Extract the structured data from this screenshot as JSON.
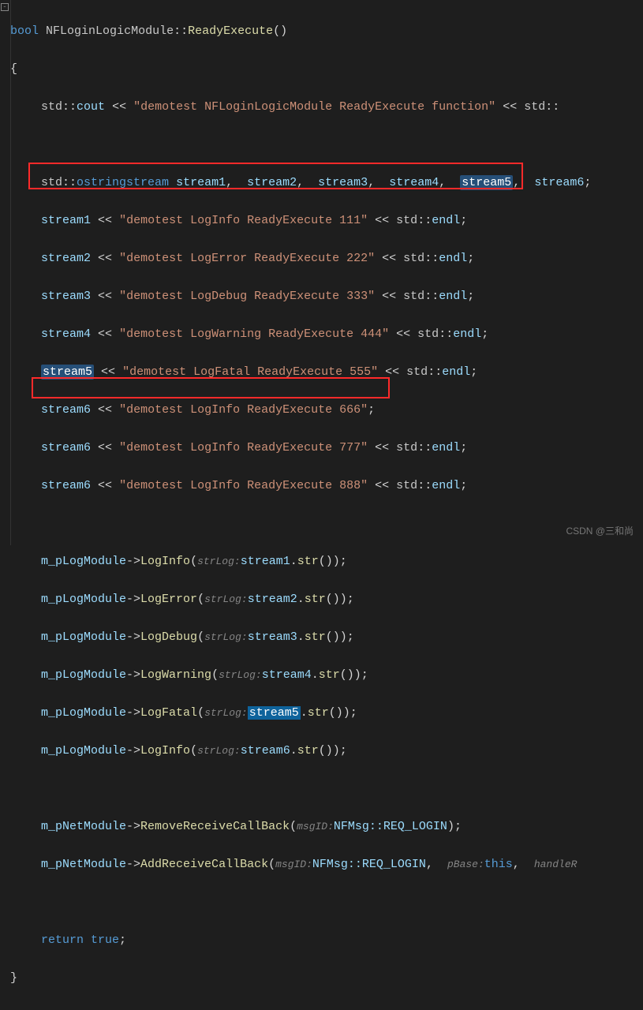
{
  "sig": {
    "ret": "bool",
    "cls": "NFLoginLogicModule",
    "fn": "ReadyExecute"
  },
  "coutLine": {
    "s": "\"demotest NFLoginLogicModule ReadyExecute function\""
  },
  "decl": {
    "type": "ostringstream",
    "vars": [
      "stream1",
      "stream2",
      "stream3",
      "stream4",
      "stream5",
      "stream6"
    ]
  },
  "streams": [
    {
      "name": "stream1",
      "str": "\"demotest LogInfo ReadyExecute 111\"",
      "tail": " << std::endl;"
    },
    {
      "name": "stream2",
      "str": "\"demotest LogError ReadyExecute 222\"",
      "tail": " << std::endl;"
    },
    {
      "name": "stream3",
      "str": "\"demotest LogDebug ReadyExecute 333\"",
      "tail": " << std::endl;"
    },
    {
      "name": "stream4",
      "str": "\"demotest LogWarning ReadyExecute 444\"",
      "tail": " << std::endl;"
    },
    {
      "name": "stream5",
      "str": "\"demotest LogFatal ReadyExecute 555\"",
      "tail": " << std::endl;"
    },
    {
      "name": "stream6",
      "str": "\"demotest LogInfo ReadyExecute 666\"",
      "tail": ";"
    },
    {
      "name": "stream6",
      "str": "\"demotest LogInfo ReadyExecute 777\"",
      "tail": " << std::endl;"
    },
    {
      "name": "stream6",
      "str": "\"demotest LogInfo ReadyExecute 888\"",
      "tail": " << std::endl;"
    }
  ],
  "logCalls": [
    {
      "fn": "LogInfo",
      "arg": "stream1"
    },
    {
      "fn": "LogError",
      "arg": "stream2"
    },
    {
      "fn": "LogDebug",
      "arg": "stream3"
    },
    {
      "fn": "LogWarning",
      "arg": "stream4"
    },
    {
      "fn": "LogFatal",
      "arg": "stream5"
    },
    {
      "fn": "LogInfo",
      "arg": "stream6"
    }
  ],
  "net": {
    "remove": {
      "fn": "RemoveReceiveCallBack",
      "hint": "msgID:",
      "arg": "NFMsg::REQ_LOGIN"
    },
    "add": {
      "fn": "AddReceiveCallBack",
      "hint1": "msgID:",
      "arg1": "NFMsg::REQ_LOGIN",
      "hint2": "pBase:",
      "arg2": "this",
      "hint3": "handleR"
    }
  },
  "hints": {
    "strLog": "strLog:"
  },
  "ret": {
    "kw": "return",
    "val": "true"
  },
  "watermark": "CSDN @三和尚"
}
